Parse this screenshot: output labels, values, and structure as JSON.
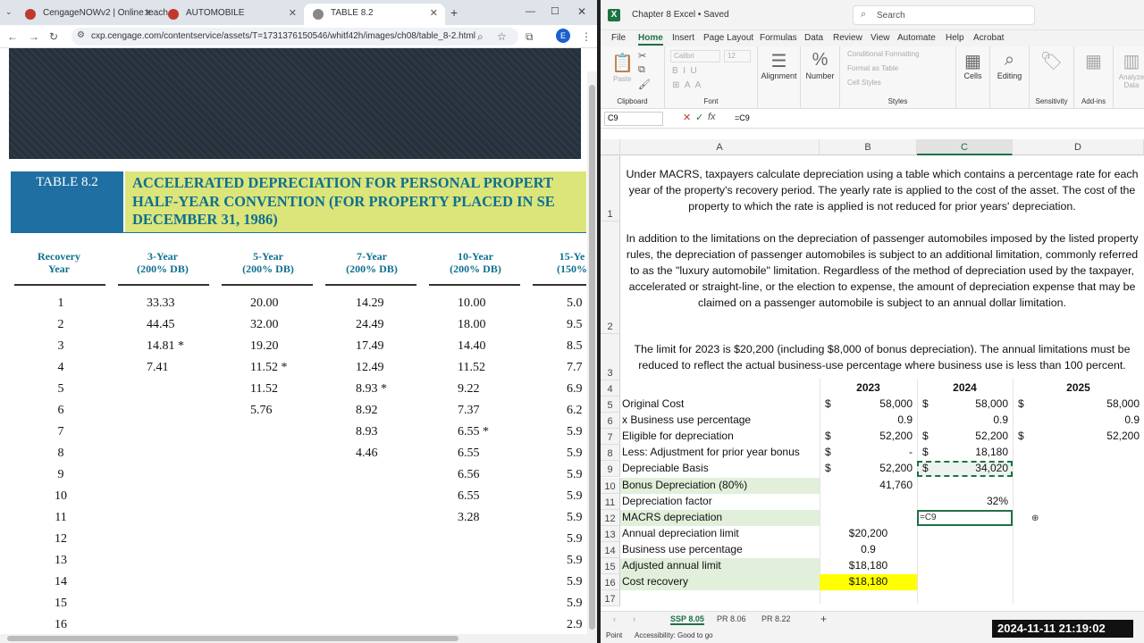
{
  "browser": {
    "tabs": [
      {
        "label": "CengageNOWv2 | Online teach"
      },
      {
        "label": "AUTOMOBILE"
      },
      {
        "label": "TABLE 8.2"
      }
    ],
    "url": "cxp.cengage.com/contentservice/assets/T=1731376150546/whitf42h/images/ch08/table_8-2.html",
    "profile": "E"
  },
  "table": {
    "label": "TABLE 8.2",
    "title_lines": [
      "ACCELERATED DEPRECIATION FOR PERSONAL PROPERT",
      "HALF-YEAR CONVENTION (FOR PROPERTY PLACED IN SE",
      "DECEMBER 31, 1986)"
    ],
    "headers": [
      [
        "Recovery",
        "Year"
      ],
      [
        "3-Year",
        "(200% DB)"
      ],
      [
        "5-Year",
        "(200% DB)"
      ],
      [
        "7-Year",
        "(200% DB)"
      ],
      [
        "10-Year",
        "(200% DB)"
      ],
      [
        "15-Ye",
        "(150%"
      ]
    ],
    "years": [
      "1",
      "2",
      "3",
      "4",
      "5",
      "6",
      "7",
      "8",
      "9",
      "10",
      "11",
      "12",
      "13",
      "14",
      "15",
      "16"
    ],
    "col3": [
      "33.33",
      "44.45",
      "14.81 *",
      "7.41"
    ],
    "col5": [
      "20.00",
      "32.00",
      "19.20",
      "11.52 *",
      "11.52",
      "5.76"
    ],
    "col7": [
      "14.29",
      "24.49",
      "17.49",
      "12.49",
      "8.93 *",
      "8.92",
      "8.93",
      "4.46"
    ],
    "col10": [
      "10.00",
      "18.00",
      "14.40",
      "11.52",
      "9.22",
      "7.37",
      "6.55 *",
      "6.55",
      "6.56",
      "6.55",
      "3.28"
    ],
    "col15": [
      "5.0",
      "9.5",
      "8.5",
      "7.7",
      "6.9",
      "6.2",
      "5.9",
      "5.9",
      "5.9",
      "5.9",
      "5.9",
      "5.9",
      "5.9",
      "5.9",
      "5.9",
      "2.9"
    ]
  },
  "excel": {
    "doc": "Chapter 8 Excel • Saved",
    "search": "Search",
    "menu": [
      "File",
      "Home",
      "Insert",
      "Page Layout",
      "Formulas",
      "Data",
      "Review",
      "View",
      "Automate",
      "Help",
      "Acrobat"
    ],
    "ribbon": {
      "clipboard": "Clipboard",
      "paste": "Paste",
      "font": "Font",
      "font_name": "Calibri",
      "font_size": "12",
      "alignment": "Alignment",
      "number": "Number",
      "cond": "Conditional Formatting",
      "fmt_table": "Format as Table",
      "cell_styles": "Cell Styles",
      "styles": "Styles",
      "cells": "Cells",
      "editing": "Editing",
      "sensitivity": "Sensitivity",
      "addins": "Add-ins",
      "analyze": "Analyze Data"
    },
    "namebox": "C9",
    "formula": "=C9",
    "columns": [
      "A",
      "B",
      "C",
      "D"
    ],
    "para1": "Under MACRS, taxpayers calculate depreciation using a table which contains a percentage rate for each year of the property's recovery period. The yearly rate is applied to the cost of the asset. The cost of the property to which the rate is applied is not reduced for prior years' depreciation.",
    "para2": "In addition to the limitations on the depreciation of passenger automobiles imposed by the listed property rules, the depreciation of passenger automobiles is subject to an additional limitation, commonly referred to as the \"luxury automobile\" limitation. Regardless of the method of depreciation used by the taxpayer, accelerated or straight-line, or the election to expense, the amount of depreciation expense that may be claimed on a passenger automobile is subject to an annual dollar limitation.",
    "para3": "The limit for 2023 is $20,200 (including $8,000 of bonus depreciation). The annual limitations must be reduced to reflect the actual business-use percentage where business use is less than 100 percent.",
    "years": [
      "2023",
      "2024",
      "2025"
    ],
    "rows": [
      {
        "n": "5",
        "a": "Original Cost",
        "b$": "$",
        "b": "58,000",
        "c$": "$",
        "c": "58,000",
        "d$": "$",
        "d": "58,000"
      },
      {
        "n": "6",
        "a": "x Business use percentage",
        "b$": "",
        "b": "0.9",
        "c$": "",
        "c": "0.9",
        "d$": "",
        "d": "0.9"
      },
      {
        "n": "7",
        "a": "Eligible for depreciation",
        "b$": "$",
        "b": "52,200",
        "c$": "$",
        "c": "52,200",
        "d$": "$",
        "d": "52,200"
      },
      {
        "n": "8",
        "a": "Less: Adjustment for prior year bonus",
        "b$": "$",
        "b": "-",
        "c$": "$",
        "c": "18,180",
        "d$": "",
        "d": ""
      },
      {
        "n": "9",
        "a": "Depreciable Basis",
        "b$": "$",
        "b": "52,200",
        "c$": "$",
        "c": "34,020",
        "d$": "",
        "d": ""
      },
      {
        "n": "10",
        "a": "Bonus Depreciation (80%)",
        "b$": "",
        "b": "41,760",
        "c$": "",
        "c": "",
        "d$": "",
        "d": ""
      },
      {
        "n": "11",
        "a": "Depreciation factor",
        "b$": "",
        "b": "",
        "c$": "",
        "c": "32%",
        "d$": "",
        "d": ""
      },
      {
        "n": "12",
        "a": "MACRS depreciation",
        "b$": "",
        "b": "",
        "c$": "",
        "c": "=C9",
        "d$": "",
        "d": ""
      },
      {
        "n": "13",
        "a": "Annual depreciation limit",
        "b$": "",
        "b": "$20,200",
        "c$": "",
        "c": "",
        "d$": "",
        "d": ""
      },
      {
        "n": "14",
        "a": "Business use percentage",
        "b$": "",
        "b": "0.9",
        "c$": "",
        "c": "",
        "d$": "",
        "d": ""
      },
      {
        "n": "15",
        "a": "Adjusted annual limit",
        "b$": "",
        "b": "$18,180",
        "c$": "",
        "c": "",
        "d$": "",
        "d": ""
      },
      {
        "n": "16",
        "a": "Cost recovery",
        "b$": "",
        "b": "$18,180",
        "c$": "",
        "c": "",
        "d$": "",
        "d": ""
      },
      {
        "n": "17",
        "a": "",
        "b$": "",
        "b": "",
        "c$": "",
        "c": "",
        "d$": "",
        "d": ""
      }
    ],
    "sheets": [
      "SSP 8.05",
      "PR 8.06",
      "PR 8.22"
    ],
    "status": {
      "mode": "Point",
      "access": "Accessibility: Good to go"
    }
  },
  "timestamp": "2024-11-11 21:19:02",
  "colors": {
    "excel_green": "#1e7145",
    "highlight_green": "#e2efda",
    "highlight_yellow": "#ffff00",
    "table_blue": "#1f6fa3",
    "table_title_bg": "#dbe57a"
  }
}
